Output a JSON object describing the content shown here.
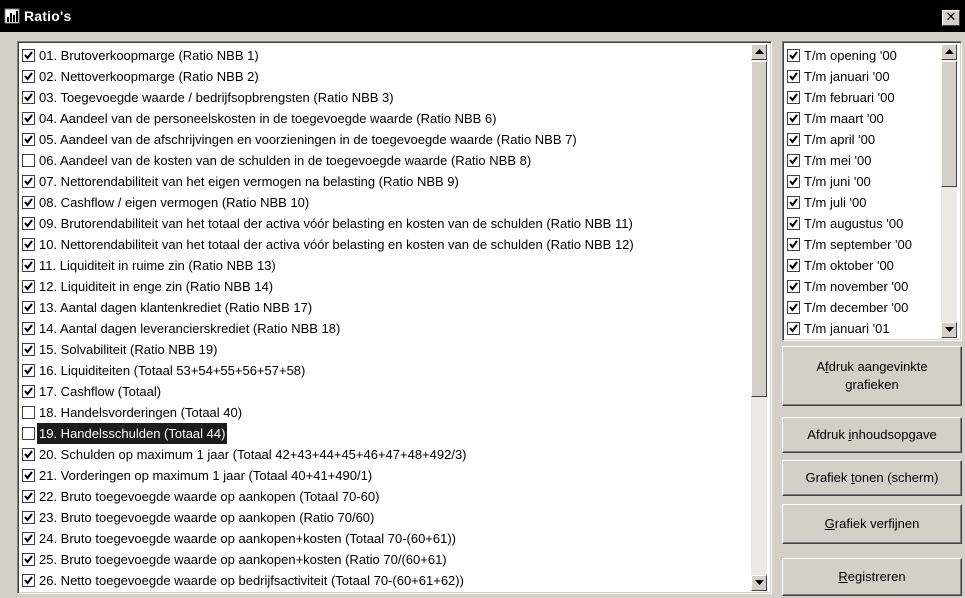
{
  "window": {
    "title": "Ratio's",
    "close_glyph": "✕",
    "icon": "chart-window-icon"
  },
  "ratios": [
    {
      "label": "01. Brutoverkoopmarge (Ratio NBB 1)",
      "checked": true
    },
    {
      "label": "02. Nettoverkoopmarge (Ratio NBB 2)",
      "checked": true
    },
    {
      "label": "03. Toegevoegde waarde / bedrijfsopbrengsten (Ratio NBB 3)",
      "checked": true
    },
    {
      "label": "04. Aandeel van de personeelskosten in de toegevoegde waarde (Ratio NBB 6)",
      "checked": true
    },
    {
      "label": "05. Aandeel van de afschrijvingen en voorzieningen in de toegevoegde waarde (Ratio NBB 7)",
      "checked": true
    },
    {
      "label": "06. Aandeel van de kosten van de schulden in de toegevoegde waarde (Ratio NBB 8)",
      "checked": false
    },
    {
      "label": "07. Nettorendabiliteit van het eigen vermogen na belasting (Ratio NBB 9)",
      "checked": true
    },
    {
      "label": "08. Cashflow / eigen vermogen (Ratio NBB 10)",
      "checked": true
    },
    {
      "label": "09. Brutorendabiliteit van het totaal der activa vóór belasting en kosten van de schulden (Ratio NBB 11)",
      "checked": true
    },
    {
      "label": "10. Nettorendabiliteit van het totaal der activa vóór belasting en kosten van de schulden (Ratio NBB 12)",
      "checked": true
    },
    {
      "label": "11. Liquiditeit in ruime zin (Ratio NBB 13)",
      "checked": true
    },
    {
      "label": "12. Liquiditeit in enge zin (Ratio NBB 14)",
      "checked": true
    },
    {
      "label": "13. Aantal dagen klantenkrediet (Ratio NBB 17)",
      "checked": true
    },
    {
      "label": "14. Aantal dagen leverancierskrediet (Ratio NBB 18)",
      "checked": true
    },
    {
      "label": "15. Solvabiliteit (Ratio NBB 19)",
      "checked": true
    },
    {
      "label": "16. Liquiditeiten (Totaal 53+54+55+56+57+58)",
      "checked": true
    },
    {
      "label": "17. Cashflow (Totaal)",
      "checked": true
    },
    {
      "label": "18. Handelsvorderingen (Totaal 40)",
      "checked": false
    },
    {
      "label": "19. Handelsschulden (Totaal 44)",
      "checked": false,
      "selected": true
    },
    {
      "label": "20. Schulden op maximum 1 jaar (Totaal 42+43+44+45+46+47+48+492/3)",
      "checked": true
    },
    {
      "label": "21. Vorderingen op maximum 1 jaar (Totaal 40+41+490/1)",
      "checked": true
    },
    {
      "label": "22. Bruto toegevoegde waarde op aankopen (Totaal 70-60)",
      "checked": true
    },
    {
      "label": "23. Bruto toegevoegde waarde op aankopen (Ratio 70/60)",
      "checked": true
    },
    {
      "label": "24. Bruto toegevoegde waarde op aankopen+kosten (Totaal 70-(60+61))",
      "checked": true
    },
    {
      "label": "25. Bruto toegevoegde waarde op aankopen+kosten (Ratio 70/(60+61)",
      "checked": true
    },
    {
      "label": "26. Netto toegevoegde waarde op bedrijfsactiviteit (Totaal 70-(60+61+62))",
      "checked": true
    }
  ],
  "periods": [
    {
      "label": "T/m opening '00",
      "checked": true
    },
    {
      "label": "T/m januari '00",
      "checked": true
    },
    {
      "label": "T/m februari '00",
      "checked": true
    },
    {
      "label": "T/m maart '00",
      "checked": true
    },
    {
      "label": "T/m april '00",
      "checked": true
    },
    {
      "label": "T/m mei '00",
      "checked": true
    },
    {
      "label": "T/m juni '00",
      "checked": true
    },
    {
      "label": "T/m juli '00",
      "checked": true
    },
    {
      "label": "T/m augustus '00",
      "checked": true
    },
    {
      "label": "T/m september '00",
      "checked": true
    },
    {
      "label": "T/m oktober '00",
      "checked": true
    },
    {
      "label": "T/m november '00",
      "checked": true
    },
    {
      "label": "T/m december '00",
      "checked": true
    },
    {
      "label": "T/m januari '01",
      "checked": true
    }
  ],
  "buttons": {
    "print_checked": {
      "pre": "A",
      "u": "f",
      "post": "druk aangevinkte",
      "line2": "grafieken"
    },
    "print_toc": {
      "pre": "Afdruk ",
      "u": "i",
      "post": "nhoudsopgave"
    },
    "show_chart": {
      "pre": "Grafiek ",
      "u": "t",
      "post": "onen (scherm)"
    },
    "refine_chart": {
      "pre": "",
      "u": "G",
      "post": "rafiek verfijnen"
    },
    "register": {
      "pre": "",
      "u": "R",
      "post": "egistreren"
    }
  }
}
